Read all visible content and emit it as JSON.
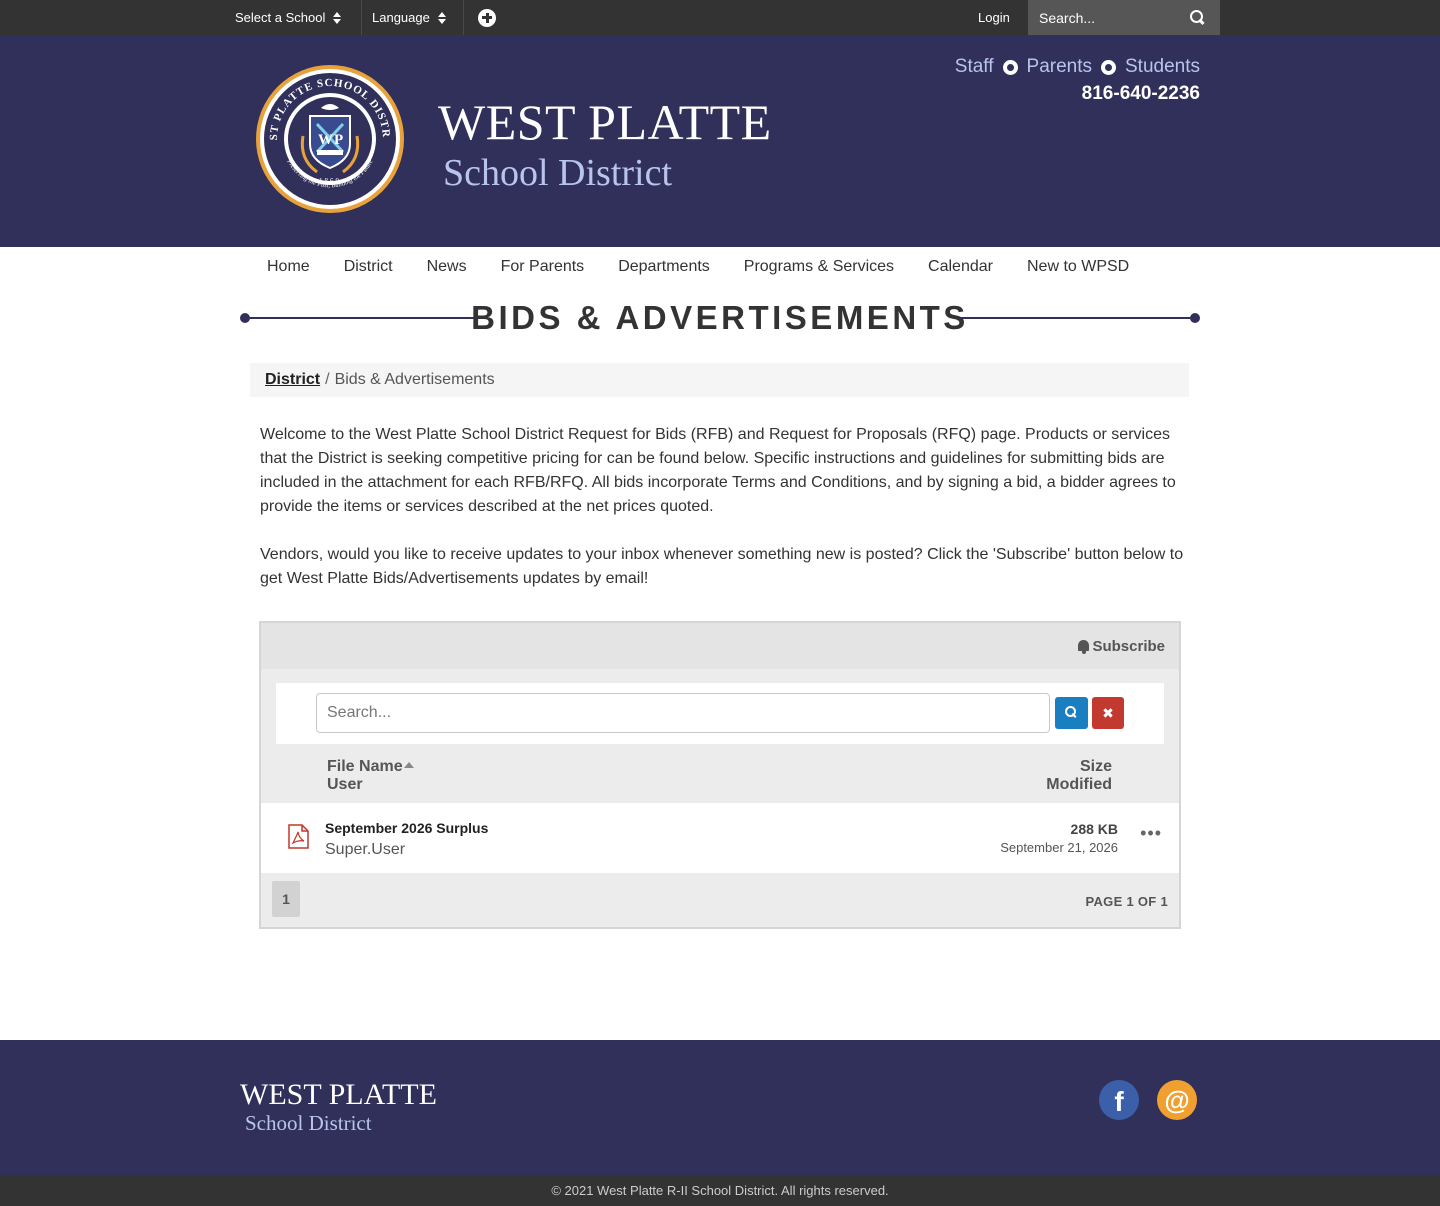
{
  "topbar": {
    "select_school": "Select a School",
    "language": "Language",
    "login": "Login",
    "search_placeholder": "Search..."
  },
  "header": {
    "seal": {
      "ring_text": "WEST PLATTE SCHOOL DISTRICT",
      "motto": "Preserving the Past, Building the Future",
      "year": "1869",
      "monogram_left": "W",
      "monogram_right": "P"
    },
    "title": "WEST PLATTE",
    "subtitle": "School District",
    "audience_links": [
      "Staff",
      "Parents",
      "Students"
    ],
    "phone": "816-640-2236"
  },
  "nav": {
    "items": [
      "Home",
      "District",
      "News",
      "For Parents",
      "Departments",
      "Programs & Services",
      "Calendar",
      "New to WPSD"
    ]
  },
  "page": {
    "title": "BIDS & ADVERTISEMENTS",
    "breadcrumb": {
      "parent": "District",
      "separator": "/",
      "current": "Bids & Advertisements"
    },
    "intro": [
      "Welcome to the West Platte School District Request for Bids (RFB) and Request for Proposals (RFQ) page. Products or services that the District is seeking competitive pricing for can be found below. Specific instructions and guidelines for submitting bids are included in the attachment for each RFB/RFQ. All bids incorporate Terms and Conditions, and by signing a bid, a bidder agrees to provide the items or services described at the net prices quoted.",
      "Vendors, would you like to receive updates to your inbox whenever something new is posted? Click the 'Subscribe' button below to get West Platte Bids/Advertisements updates by email!"
    ]
  },
  "documents": {
    "subscribe_label": "Subscribe",
    "search_placeholder": "Search...",
    "clear_glyph": "✖",
    "columns": {
      "name": "File Name",
      "user": "User",
      "size": "Size",
      "modified": "Modified"
    },
    "rows": [
      {
        "name": "September 2026 Surplus",
        "user": "Super.User",
        "size": "288 KB",
        "modified": "September 21, 2026",
        "icon": "pdf-icon",
        "more": "•••"
      }
    ],
    "pager": {
      "current": "1",
      "summary": "PAGE 1 OF 1"
    }
  },
  "footer": {
    "title": "WEST PLATTE",
    "subtitle": "School District",
    "facebook_glyph": "f",
    "email_glyph": "@",
    "copyright": "© 2021 West Platte R-II School District. All rights reserved."
  },
  "colors": {
    "brand_navy": "#30305a",
    "brand_light": "#b9c4ee",
    "topbar": "#333333",
    "search_button": "#1a7fc1",
    "clear_button": "#c23a2f",
    "facebook": "#3b5fa8",
    "email": "#f0a030"
  }
}
